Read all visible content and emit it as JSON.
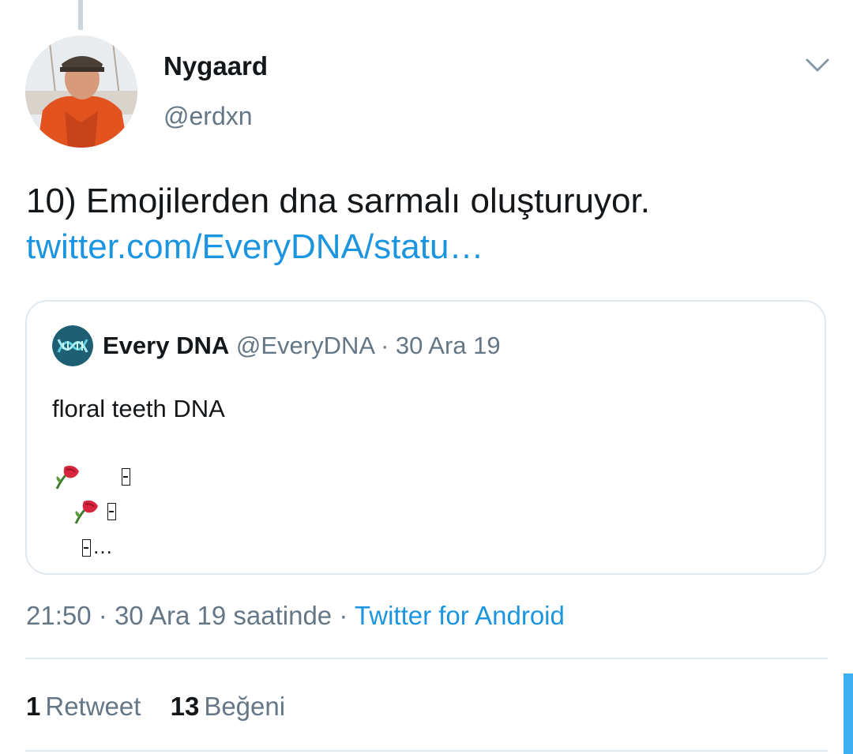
{
  "tweet": {
    "display_name": "Nygaard",
    "handle": "@erdxn",
    "text": "10) Emojilerden dna sarmalı oluşturuyor.",
    "link_text": "twitter.com/EveryDNA/statu…",
    "menu_icon": "chevron-down-icon"
  },
  "quote": {
    "name": "Every DNA",
    "handle": "@EveryDNA",
    "separator": "·",
    "date": "30 Ara 19",
    "text": "floral teeth DNA",
    "emoji_lines": [
      "🥀 ▯",
      "🥀▯",
      "▯…"
    ]
  },
  "meta": {
    "time": "21:50",
    "sep1": "·",
    "date_text": "30 Ara 19 saatinde",
    "sep2": "·",
    "source": "Twitter for Android"
  },
  "stats": {
    "retweet_count": "1",
    "retweet_label": "Retweet",
    "like_count": "13",
    "like_label": "Beğeni"
  },
  "colors": {
    "link": "#1b95e0",
    "secondary_text": "#657786",
    "border": "#e1e8ed",
    "accent": "#1da1f2"
  }
}
